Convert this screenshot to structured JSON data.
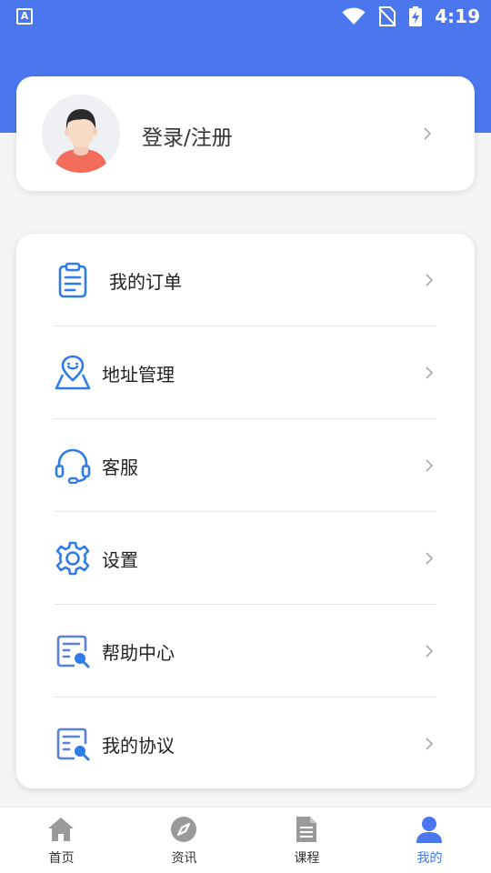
{
  "status_bar": {
    "app_badge": "A",
    "time": "4:19"
  },
  "profile": {
    "login_label": "登录/注册"
  },
  "menu": {
    "items": [
      {
        "label": "我的订单",
        "icon": "clipboard-icon"
      },
      {
        "label": "地址管理",
        "icon": "address-pin-icon"
      },
      {
        "label": "客服",
        "icon": "headset-icon"
      },
      {
        "label": "设置",
        "icon": "gear-icon"
      },
      {
        "label": "帮助中心",
        "icon": "help-doc-search-icon"
      },
      {
        "label": "我的协议",
        "icon": "agreement-doc-search-icon"
      }
    ]
  },
  "tabs": {
    "items": [
      {
        "label": "首页",
        "icon": "home-icon"
      },
      {
        "label": "资讯",
        "icon": "compass-icon"
      },
      {
        "label": "课程",
        "icon": "document-icon"
      },
      {
        "label": "我的",
        "icon": "person-icon"
      }
    ],
    "active_index": 3
  },
  "colors": {
    "accent": "#4b77ee",
    "icon_blue": "#2f7be8",
    "tab_gray": "#9a9a9a"
  }
}
